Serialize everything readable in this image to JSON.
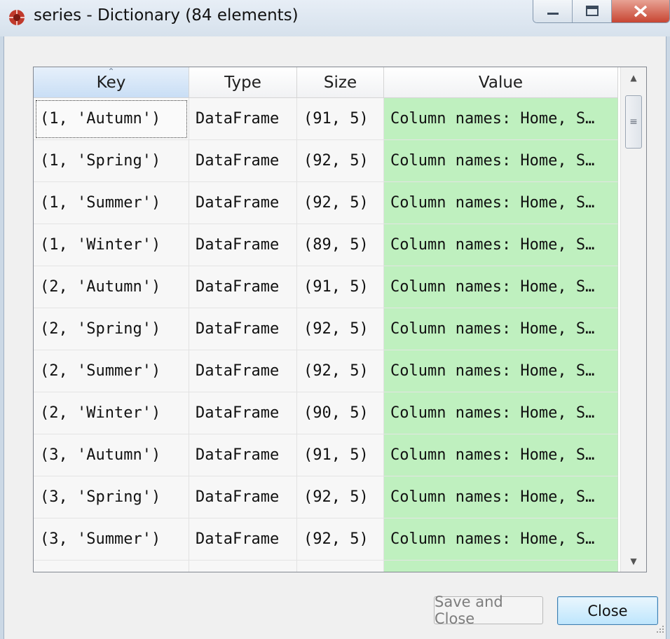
{
  "window": {
    "title": "series - Dictionary (84 elements)",
    "icon": "spyder-icon",
    "controls": [
      "minimize-icon",
      "maximize-icon",
      "close-icon"
    ]
  },
  "table": {
    "columns": [
      "Key",
      "Type",
      "Size",
      "Value"
    ],
    "sorted_column": "Key",
    "rows": [
      [
        "(1, 'Autumn')",
        "DataFrame",
        "(91, 5)",
        "Column names: Home, S…"
      ],
      [
        "(1, 'Spring')",
        "DataFrame",
        "(92, 5)",
        "Column names: Home, S…"
      ],
      [
        "(1, 'Summer')",
        "DataFrame",
        "(92, 5)",
        "Column names: Home, S…"
      ],
      [
        "(1, 'Winter')",
        "DataFrame",
        "(89, 5)",
        "Column names: Home, S…"
      ],
      [
        "(2, 'Autumn')",
        "DataFrame",
        "(91, 5)",
        "Column names: Home, S…"
      ],
      [
        "(2, 'Spring')",
        "DataFrame",
        "(92, 5)",
        "Column names: Home, S…"
      ],
      [
        "(2, 'Summer')",
        "DataFrame",
        "(92, 5)",
        "Column names: Home, S…"
      ],
      [
        "(2, 'Winter')",
        "DataFrame",
        "(90, 5)",
        "Column names: Home, S…"
      ],
      [
        "(3, 'Autumn')",
        "DataFrame",
        "(91, 5)",
        "Column names: Home, S…"
      ],
      [
        "(3, 'Spring')",
        "DataFrame",
        "(92, 5)",
        "Column names: Home, S…"
      ],
      [
        "(3, 'Summer')",
        "DataFrame",
        "(92, 5)",
        "Column names: Home, S…"
      ],
      [
        "",
        "",
        "",
        ""
      ]
    ],
    "value_color": "#bff0bf"
  },
  "buttons": {
    "save_and_close": "Save and Close",
    "close": "Close"
  }
}
